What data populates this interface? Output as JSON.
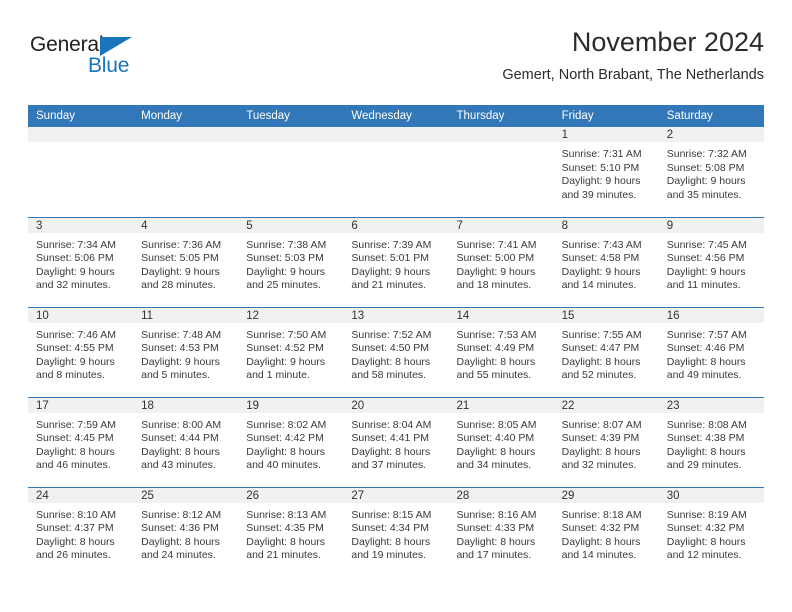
{
  "brand": {
    "word_one": "General",
    "word_two": "Blue",
    "triangle_icon": "brand-triangle-icon",
    "accent_color": "#1b75bb",
    "text_color": "#231f20"
  },
  "header": {
    "title": "November 2024",
    "subtitle": "Gemert, North Brabant, The Netherlands"
  },
  "theme": {
    "header_bg": "#3277b8",
    "header_text": "#ffffff",
    "daynum_band_bg": "#f1f1f1",
    "row_divider": "#3277b8",
    "body_text": "#3a3a3a",
    "page_bg": "#ffffff"
  },
  "weekday_headers": [
    "Sunday",
    "Monday",
    "Tuesday",
    "Wednesday",
    "Thursday",
    "Friday",
    "Saturday"
  ],
  "labels": {
    "sunrise_prefix": "Sunrise:",
    "sunset_prefix": "Sunset:",
    "daylight_prefix": "Daylight:"
  },
  "weeks": [
    [
      {
        "day": "",
        "empty": true
      },
      {
        "day": "",
        "empty": true
      },
      {
        "day": "",
        "empty": true
      },
      {
        "day": "",
        "empty": true
      },
      {
        "day": "",
        "empty": true
      },
      {
        "day": "1",
        "sunrise": "Sunrise: 7:31 AM",
        "sunset": "Sunset: 5:10 PM",
        "daylight_line1": "Daylight: 9 hours",
        "daylight_line2": "and 39 minutes."
      },
      {
        "day": "2",
        "sunrise": "Sunrise: 7:32 AM",
        "sunset": "Sunset: 5:08 PM",
        "daylight_line1": "Daylight: 9 hours",
        "daylight_line2": "and 35 minutes."
      }
    ],
    [
      {
        "day": "3",
        "sunrise": "Sunrise: 7:34 AM",
        "sunset": "Sunset: 5:06 PM",
        "daylight_line1": "Daylight: 9 hours",
        "daylight_line2": "and 32 minutes."
      },
      {
        "day": "4",
        "sunrise": "Sunrise: 7:36 AM",
        "sunset": "Sunset: 5:05 PM",
        "daylight_line1": "Daylight: 9 hours",
        "daylight_line2": "and 28 minutes."
      },
      {
        "day": "5",
        "sunrise": "Sunrise: 7:38 AM",
        "sunset": "Sunset: 5:03 PM",
        "daylight_line1": "Daylight: 9 hours",
        "daylight_line2": "and 25 minutes."
      },
      {
        "day": "6",
        "sunrise": "Sunrise: 7:39 AM",
        "sunset": "Sunset: 5:01 PM",
        "daylight_line1": "Daylight: 9 hours",
        "daylight_line2": "and 21 minutes."
      },
      {
        "day": "7",
        "sunrise": "Sunrise: 7:41 AM",
        "sunset": "Sunset: 5:00 PM",
        "daylight_line1": "Daylight: 9 hours",
        "daylight_line2": "and 18 minutes."
      },
      {
        "day": "8",
        "sunrise": "Sunrise: 7:43 AM",
        "sunset": "Sunset: 4:58 PM",
        "daylight_line1": "Daylight: 9 hours",
        "daylight_line2": "and 14 minutes."
      },
      {
        "day": "9",
        "sunrise": "Sunrise: 7:45 AM",
        "sunset": "Sunset: 4:56 PM",
        "daylight_line1": "Daylight: 9 hours",
        "daylight_line2": "and 11 minutes."
      }
    ],
    [
      {
        "day": "10",
        "sunrise": "Sunrise: 7:46 AM",
        "sunset": "Sunset: 4:55 PM",
        "daylight_line1": "Daylight: 9 hours",
        "daylight_line2": "and 8 minutes."
      },
      {
        "day": "11",
        "sunrise": "Sunrise: 7:48 AM",
        "sunset": "Sunset: 4:53 PM",
        "daylight_line1": "Daylight: 9 hours",
        "daylight_line2": "and 5 minutes."
      },
      {
        "day": "12",
        "sunrise": "Sunrise: 7:50 AM",
        "sunset": "Sunset: 4:52 PM",
        "daylight_line1": "Daylight: 9 hours",
        "daylight_line2": "and 1 minute."
      },
      {
        "day": "13",
        "sunrise": "Sunrise: 7:52 AM",
        "sunset": "Sunset: 4:50 PM",
        "daylight_line1": "Daylight: 8 hours",
        "daylight_line2": "and 58 minutes."
      },
      {
        "day": "14",
        "sunrise": "Sunrise: 7:53 AM",
        "sunset": "Sunset: 4:49 PM",
        "daylight_line1": "Daylight: 8 hours",
        "daylight_line2": "and 55 minutes."
      },
      {
        "day": "15",
        "sunrise": "Sunrise: 7:55 AM",
        "sunset": "Sunset: 4:47 PM",
        "daylight_line1": "Daylight: 8 hours",
        "daylight_line2": "and 52 minutes."
      },
      {
        "day": "16",
        "sunrise": "Sunrise: 7:57 AM",
        "sunset": "Sunset: 4:46 PM",
        "daylight_line1": "Daylight: 8 hours",
        "daylight_line2": "and 49 minutes."
      }
    ],
    [
      {
        "day": "17",
        "sunrise": "Sunrise: 7:59 AM",
        "sunset": "Sunset: 4:45 PM",
        "daylight_line1": "Daylight: 8 hours",
        "daylight_line2": "and 46 minutes."
      },
      {
        "day": "18",
        "sunrise": "Sunrise: 8:00 AM",
        "sunset": "Sunset: 4:44 PM",
        "daylight_line1": "Daylight: 8 hours",
        "daylight_line2": "and 43 minutes."
      },
      {
        "day": "19",
        "sunrise": "Sunrise: 8:02 AM",
        "sunset": "Sunset: 4:42 PM",
        "daylight_line1": "Daylight: 8 hours",
        "daylight_line2": "and 40 minutes."
      },
      {
        "day": "20",
        "sunrise": "Sunrise: 8:04 AM",
        "sunset": "Sunset: 4:41 PM",
        "daylight_line1": "Daylight: 8 hours",
        "daylight_line2": "and 37 minutes."
      },
      {
        "day": "21",
        "sunrise": "Sunrise: 8:05 AM",
        "sunset": "Sunset: 4:40 PM",
        "daylight_line1": "Daylight: 8 hours",
        "daylight_line2": "and 34 minutes."
      },
      {
        "day": "22",
        "sunrise": "Sunrise: 8:07 AM",
        "sunset": "Sunset: 4:39 PM",
        "daylight_line1": "Daylight: 8 hours",
        "daylight_line2": "and 32 minutes."
      },
      {
        "day": "23",
        "sunrise": "Sunrise: 8:08 AM",
        "sunset": "Sunset: 4:38 PM",
        "daylight_line1": "Daylight: 8 hours",
        "daylight_line2": "and 29 minutes."
      }
    ],
    [
      {
        "day": "24",
        "sunrise": "Sunrise: 8:10 AM",
        "sunset": "Sunset: 4:37 PM",
        "daylight_line1": "Daylight: 8 hours",
        "daylight_line2": "and 26 minutes."
      },
      {
        "day": "25",
        "sunrise": "Sunrise: 8:12 AM",
        "sunset": "Sunset: 4:36 PM",
        "daylight_line1": "Daylight: 8 hours",
        "daylight_line2": "and 24 minutes."
      },
      {
        "day": "26",
        "sunrise": "Sunrise: 8:13 AM",
        "sunset": "Sunset: 4:35 PM",
        "daylight_line1": "Daylight: 8 hours",
        "daylight_line2": "and 21 minutes."
      },
      {
        "day": "27",
        "sunrise": "Sunrise: 8:15 AM",
        "sunset": "Sunset: 4:34 PM",
        "daylight_line1": "Daylight: 8 hours",
        "daylight_line2": "and 19 minutes."
      },
      {
        "day": "28",
        "sunrise": "Sunrise: 8:16 AM",
        "sunset": "Sunset: 4:33 PM",
        "daylight_line1": "Daylight: 8 hours",
        "daylight_line2": "and 17 minutes."
      },
      {
        "day": "29",
        "sunrise": "Sunrise: 8:18 AM",
        "sunset": "Sunset: 4:32 PM",
        "daylight_line1": "Daylight: 8 hours",
        "daylight_line2": "and 14 minutes."
      },
      {
        "day": "30",
        "sunrise": "Sunrise: 8:19 AM",
        "sunset": "Sunset: 4:32 PM",
        "daylight_line1": "Daylight: 8 hours",
        "daylight_line2": "and 12 minutes."
      }
    ]
  ]
}
